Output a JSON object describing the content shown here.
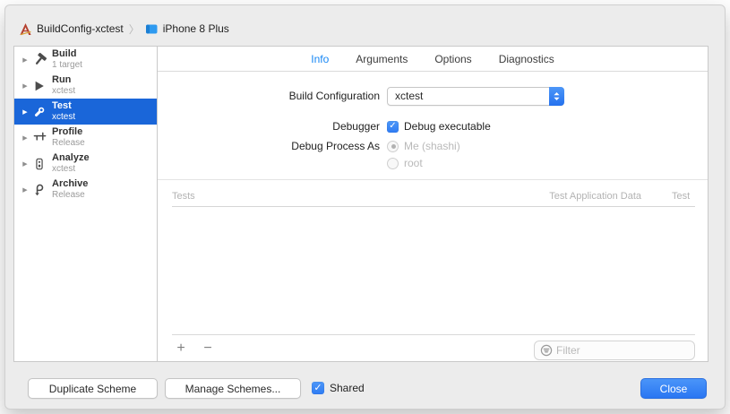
{
  "window": {
    "breadcrumb": {
      "scheme_icon": "xcode-project-icon",
      "scheme": "BuildConfig-xctest",
      "separator": "〉",
      "destination_icon": "device-icon",
      "destination": "iPhone 8 Plus"
    },
    "sidebar": {
      "items": [
        {
          "label": "Build",
          "sublabel": "1 target",
          "icon": "hammer-icon",
          "selected": false
        },
        {
          "label": "Run",
          "sublabel": "xctest",
          "icon": "play-icon",
          "selected": false
        },
        {
          "label": "Test",
          "sublabel": "xctest",
          "icon": "wrench-icon",
          "selected": true
        },
        {
          "label": "Profile",
          "sublabel": "Release",
          "icon": "caliper-icon",
          "selected": false
        },
        {
          "label": "Analyze",
          "sublabel": "xctest",
          "icon": "analyze-icon",
          "selected": false
        },
        {
          "label": "Archive",
          "sublabel": "Release",
          "icon": "archive-icon",
          "selected": false
        }
      ]
    },
    "tabs": [
      {
        "label": "Info",
        "selected": true
      },
      {
        "label": "Arguments",
        "selected": false
      },
      {
        "label": "Options",
        "selected": false
      },
      {
        "label": "Diagnostics",
        "selected": false
      }
    ],
    "form": {
      "build_configuration": {
        "label": "Build Configuration",
        "value": "xctest"
      },
      "debugger": {
        "label": "Debugger",
        "checkbox_label": "Debug executable",
        "checked": true,
        "check_glyph": "✓"
      },
      "debug_process_as": {
        "label": "Debug Process As",
        "options": [
          {
            "label": "Me (shashi)",
            "selected": true,
            "enabled": false
          },
          {
            "label": "root",
            "selected": false,
            "enabled": false
          }
        ]
      }
    },
    "tests_table": {
      "columns": [
        "Tests",
        "Test Application Data",
        "Test"
      ],
      "rows": [],
      "add_label": "+",
      "remove_label": "−",
      "filter_placeholder": "Filter"
    },
    "footer": {
      "duplicate_button": "Duplicate Scheme",
      "manage_button": "Manage Schemes...",
      "shared_label": "Shared",
      "shared_checked": true,
      "check_glyph": "✓",
      "close_button": "Close"
    },
    "colors": {
      "selection_blue": "#1a66d9",
      "tab_accent_blue": "#1787f5",
      "control_blue": "#3f8ef7",
      "close_button_blue": "#2d7ef7",
      "window_background": "#ececec",
      "disabled_gray": "#b9b9b9"
    }
  }
}
